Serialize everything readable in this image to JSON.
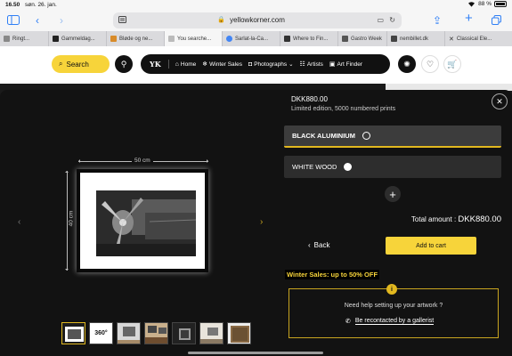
{
  "status_bar": {
    "time": "16.50",
    "date": "søn. 26. jan.",
    "battery": "88 %"
  },
  "browser": {
    "url": "yellowkorner.com",
    "text_size_label": "AA",
    "tabs": [
      {
        "label": "Ringt..."
      },
      {
        "label": "Gammeldag..."
      },
      {
        "label": "Bløde og ne..."
      },
      {
        "label": "You searche..."
      },
      {
        "label": "Sarlat-la-Ca..."
      },
      {
        "label": "Where to Fin..."
      },
      {
        "label": "Gastro Week"
      },
      {
        "label": "nembillet.dk"
      },
      {
        "label": "Classical Ele..."
      }
    ]
  },
  "header": {
    "search_label": "Search",
    "logo": "YK",
    "nav": [
      "Home",
      "Winter Sales",
      "Photographs",
      "Artists",
      "Art Finder"
    ]
  },
  "product": {
    "width_label": "50 cm",
    "height_label": "40 cm",
    "thumb_360_label": "360°"
  },
  "panel": {
    "price": "DKK880.00",
    "edition": "Limited edition, 5000 numbered prints",
    "options": [
      {
        "label": "BLACK ALUMINIUM",
        "selected": true
      },
      {
        "label": "WHITE WOOD",
        "selected": false
      }
    ],
    "total_label": "Total amount : ",
    "total_value": "DKK880.00",
    "back_label": "Back",
    "add_to_cart_label": "Add to cart",
    "sale_text": "Winter Sales: up to 50% OFF",
    "help_badge": "i",
    "help_title": "Need help setting up your artwork ?",
    "help_link": "Be recontacted by a gallerist"
  },
  "colors": {
    "accent_yellow": "#f7d43a",
    "modal_bg": "#121212",
    "link_blue": "#2f7ff5"
  }
}
